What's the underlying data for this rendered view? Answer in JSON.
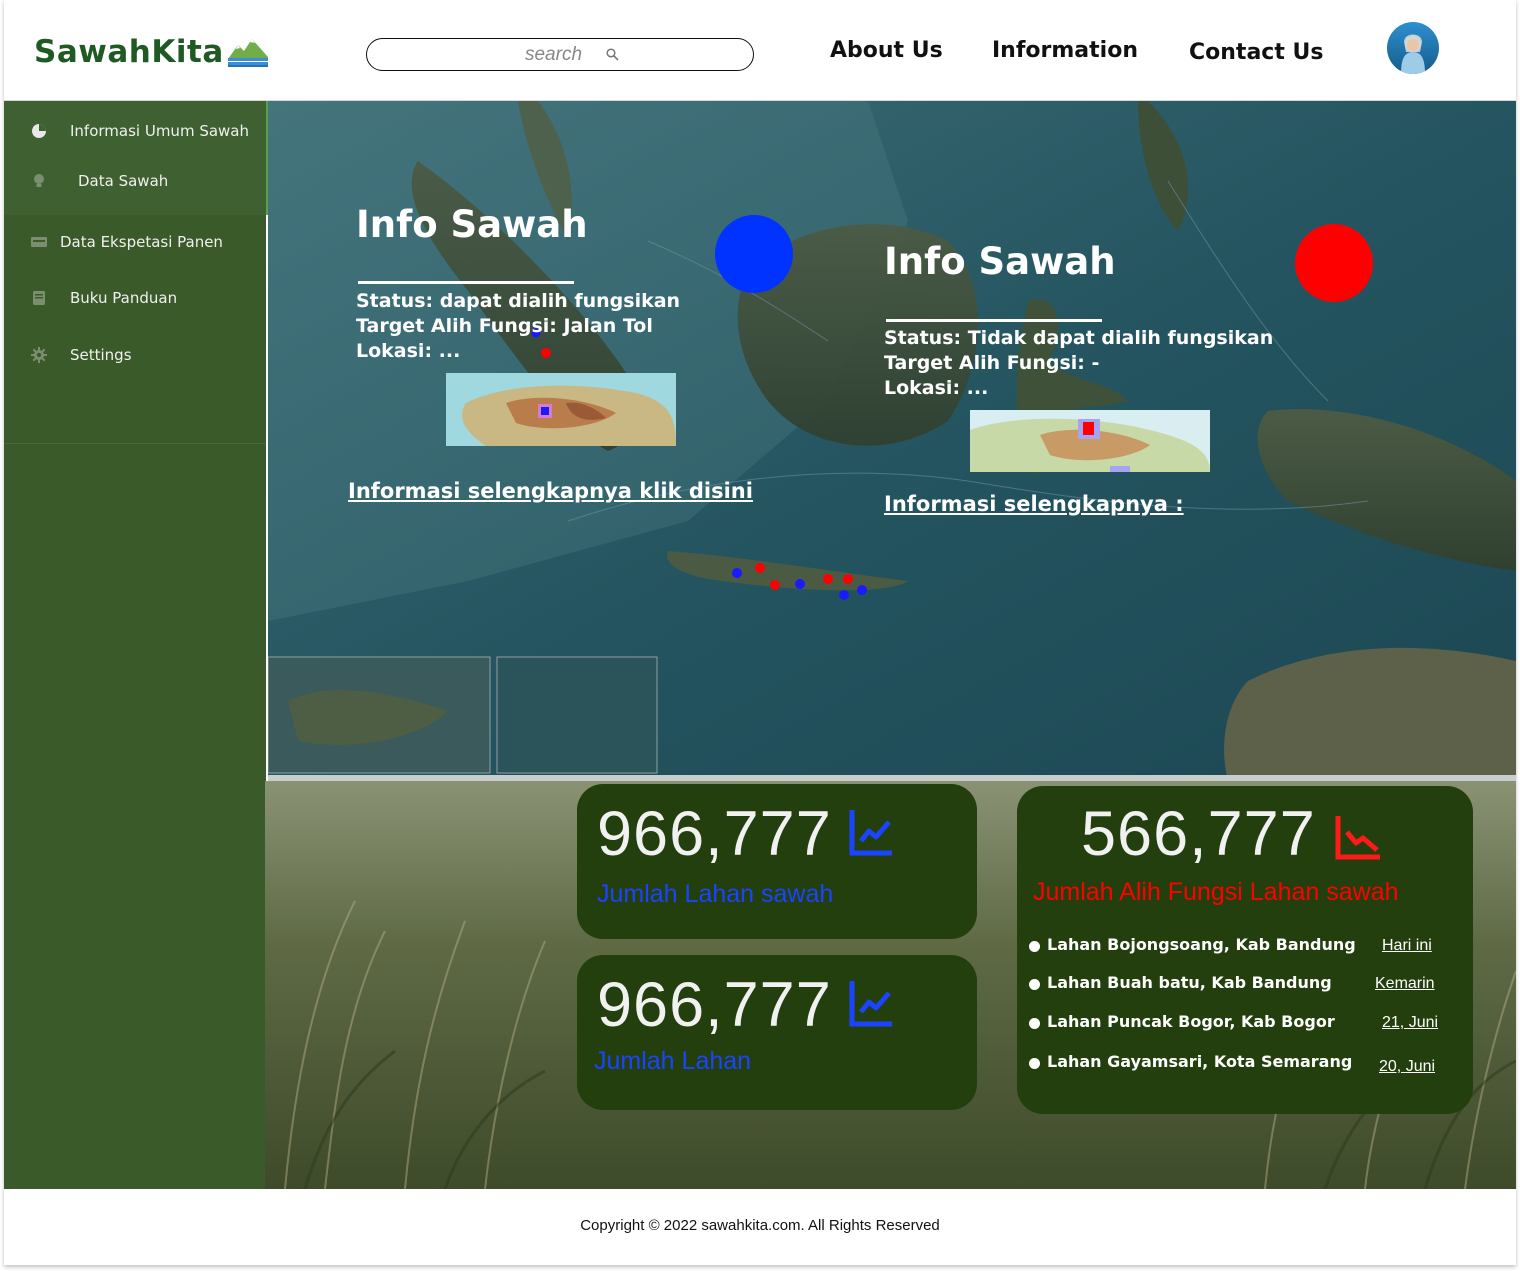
{
  "brand": {
    "name": "SawahKita"
  },
  "search": {
    "placeholder": "search"
  },
  "nav": {
    "about": "About Us",
    "information": "Information",
    "contact": "Contact Us"
  },
  "sidebar": {
    "items": [
      {
        "label": "Informasi Umum Sawah",
        "icon": "pie-chart-icon"
      },
      {
        "label": "Data Sawah",
        "icon": "lightbulb-icon"
      },
      {
        "label": "Data Ekspetasi Panen",
        "icon": "card-icon"
      },
      {
        "label": "Buku Panduan",
        "icon": "book-icon"
      },
      {
        "label": "Settings",
        "icon": "gear-icon"
      }
    ]
  },
  "info_left": {
    "title": "Info Sawah",
    "status": "Status: dapat dialih fungsikan",
    "target": "Target Alih Fungsi: Jalan Tol",
    "location": "Lokasi: ...",
    "link": "Informasi selengkapnya klik disini",
    "marker_color": "#0033ff"
  },
  "info_right": {
    "title": "Info Sawah",
    "status": "Status: Tidak dapat dialih fungsikan",
    "target": "Target Alih Fungsi: -",
    "location": "Lokasi: ...",
    "link": "Informasi selengkapnya :",
    "marker_color": "#ff0000"
  },
  "stats": {
    "card1": {
      "value": "966,777",
      "caption": "Jumlah Lahan sawah",
      "color": "#1a44ff"
    },
    "card2": {
      "value": "966,777",
      "caption": "Jumlah Lahan",
      "color": "#1a44ff"
    },
    "card3": {
      "value": "566,777",
      "caption": "Jumlah  Alih Fungsi Lahan sawah",
      "color": "#ff0000"
    }
  },
  "conversions": [
    {
      "name": "Lahan Bojongsoang, Kab Bandung",
      "when": "Hari ini"
    },
    {
      "name": "Lahan Buah batu, Kab Bandung",
      "when": "Kemarin"
    },
    {
      "name": "Lahan Puncak Bogor, Kab Bogor",
      "when": "21, Juni"
    },
    {
      "name": "Lahan Gayamsari, Kota Semarang",
      "when": "20, Juni"
    }
  ],
  "footer": {
    "copyright": "Copyright © 2022 sawahkita.com. All Rights Reserved"
  }
}
